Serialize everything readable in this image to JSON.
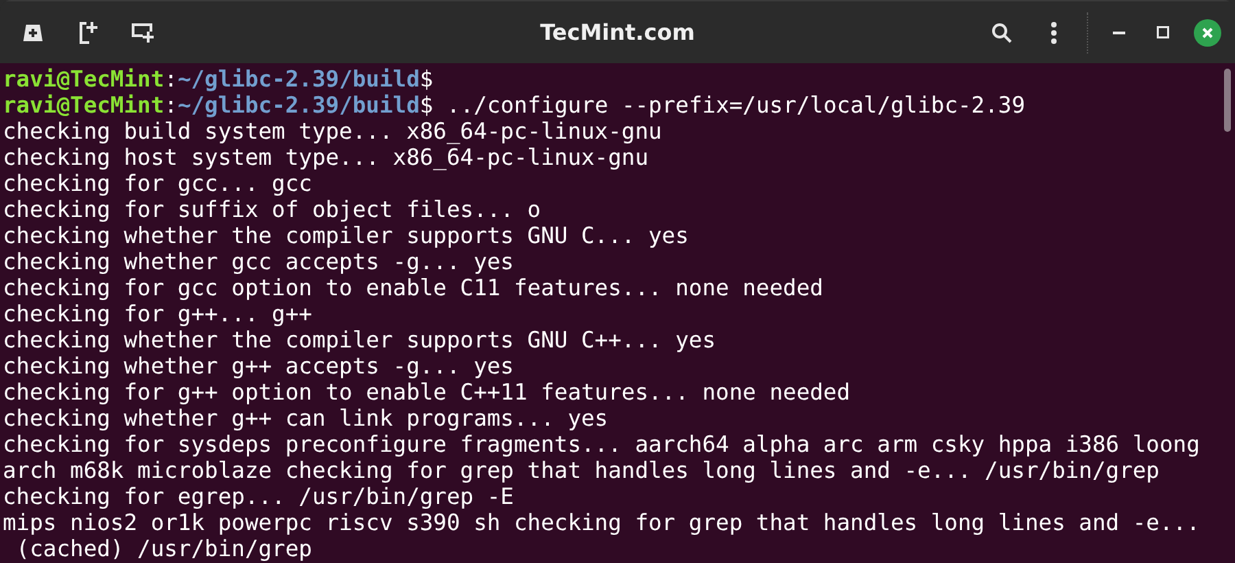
{
  "window": {
    "title": "TecMint.com"
  },
  "terminal": {
    "lines": [
      {
        "kind": "prompt",
        "user": "ravi@TecMint",
        "separator": ":",
        "path": "~/glibc-2.39/build",
        "symbol": "$"
      },
      {
        "kind": "prompt",
        "user": "ravi@TecMint",
        "separator": ":",
        "path": "~/glibc-2.39/build",
        "symbol": "$",
        "command": " ../configure --prefix=/usr/local/glibc-2.39"
      },
      {
        "kind": "output",
        "text": "checking build system type... x86_64-pc-linux-gnu"
      },
      {
        "kind": "output",
        "text": "checking host system type... x86_64-pc-linux-gnu"
      },
      {
        "kind": "output",
        "text": "checking for gcc... gcc"
      },
      {
        "kind": "output",
        "text": "checking for suffix of object files... o"
      },
      {
        "kind": "output",
        "text": "checking whether the compiler supports GNU C... yes"
      },
      {
        "kind": "output",
        "text": "checking whether gcc accepts -g... yes"
      },
      {
        "kind": "output",
        "text": "checking for gcc option to enable C11 features... none needed"
      },
      {
        "kind": "output",
        "text": "checking for g++... g++"
      },
      {
        "kind": "output",
        "text": "checking whether the compiler supports GNU C++... yes"
      },
      {
        "kind": "output",
        "text": "checking whether g++ accepts -g... yes"
      },
      {
        "kind": "output",
        "text": "checking for g++ option to enable C++11 features... none needed"
      },
      {
        "kind": "output",
        "text": "checking whether g++ can link programs... yes"
      },
      {
        "kind": "output",
        "text": "checking for sysdeps preconfigure fragments... aarch64 alpha arc arm csky hppa i386 loong"
      },
      {
        "kind": "output",
        "text": "arch m68k microblaze checking for grep that handles long lines and -e... /usr/bin/grep"
      },
      {
        "kind": "output",
        "text": "checking for egrep... /usr/bin/grep -E"
      },
      {
        "kind": "output",
        "text": "mips nios2 or1k powerpc riscv s390 sh checking for grep that handles long lines and -e..."
      },
      {
        "kind": "output",
        "text": " (cached) /usr/bin/grep"
      }
    ]
  }
}
